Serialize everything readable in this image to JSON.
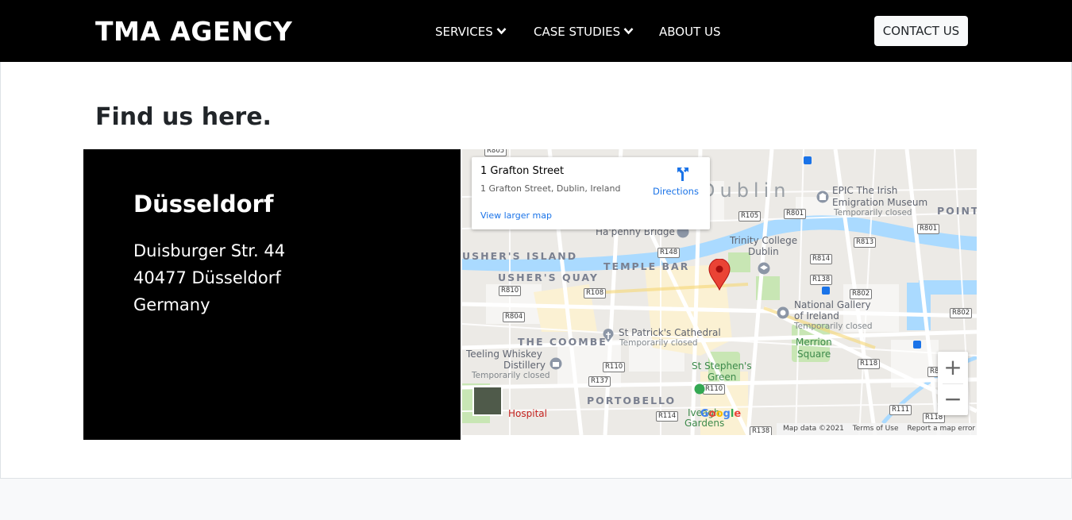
{
  "brand": "TMA AGENCY",
  "nav": {
    "services": "SERVICES",
    "case_studies": "CASE STUDIES",
    "about": "ABOUT US",
    "contact": "CONTACT US"
  },
  "section": {
    "title": "Find us here."
  },
  "address": {
    "city": "Düsseldorf",
    "street": "Duisburger Str. 44",
    "postal": "40477 Düsseldorf",
    "country": "Germany"
  },
  "map": {
    "place_title": "1 Grafton Street",
    "place_address": "1 Grafton Street, Dublin, Ireland",
    "directions": "Directions",
    "larger_map": "View larger map",
    "labels": {
      "dublin": "Dublin",
      "epic": "EPIC The Irish",
      "epic2": "Emigration Museum",
      "epic_status": "Temporarily closed",
      "point": "POINT",
      "hapenny": "Ha'penny Bridge",
      "trinity": "Trinity College",
      "trinity2": "Dublin",
      "ushers_island": "USHER'S ISLAND",
      "temple_bar": "TEMPLE BAR",
      "ushers_quay": "USHER'S QUAY",
      "national_gallery": "National Gallery",
      "national_gallery2": "of Ireland",
      "ng_status": "Temporarily closed",
      "merrion": "Merrion",
      "merrion2": "Square",
      "stpatricks": "St Patrick's Cathedral",
      "stp_status": "Temporarily closed",
      "coombe": "THE COOMBE",
      "teeling": "Teeling Whiskey",
      "teeling2": "Distillery",
      "teeling_status": "Temporarily closed",
      "ststephens": "St Stephen's",
      "ststephens2": "Green",
      "portobello": "PORTOBELLO",
      "hospital": "Hospital",
      "iveagh": "Iveagh",
      "iveagh2": "Gardens"
    },
    "roads": {
      "r805": "R805",
      "r105": "R105",
      "r801a": "R801",
      "r801b": "R801",
      "r813": "R813",
      "r148": "R148",
      "r814": "R814",
      "r138a": "R138",
      "r802a": "R802",
      "r810": "R810",
      "r108": "R108",
      "r804": "R804",
      "r802b": "R802",
      "r110a": "R110",
      "r137": "R137",
      "r118a": "R118",
      "r815": "R815",
      "r110b": "R110",
      "r114": "R114",
      "r111": "R111",
      "r118b": "R118",
      "r138b": "R138"
    },
    "zoom_in": "+",
    "zoom_out": "−",
    "google": "Google",
    "attribution": {
      "data": "Map data ©2021",
      "terms": "Terms of Use",
      "report": "Report a map error"
    }
  },
  "colors": {
    "navbar_bg": "#000000",
    "panel_bg": "#000000",
    "link_blue": "#1a73e8",
    "pin_red": "#ea4335",
    "water": "#aadaff",
    "park": "#c8e6b4"
  }
}
